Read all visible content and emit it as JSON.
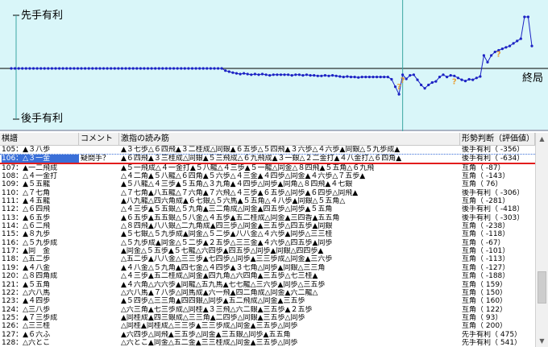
{
  "graph": {
    "label_top": "先手有利",
    "label_bottom": "後手有利",
    "label_end": "終局",
    "colors": {
      "background": "#d9f6f9",
      "line": "#1c22c4",
      "axis": "#000000",
      "grid": "#3aa6a2",
      "marker": "#e8a23a"
    },
    "current_move": 106,
    "evals": [
      0,
      0,
      0,
      0,
      0,
      0,
      0,
      0,
      0,
      0,
      0,
      0,
      0,
      0,
      0,
      0,
      0,
      0,
      0,
      0,
      0,
      0,
      0,
      0,
      0,
      0,
      0,
      0,
      0,
      0,
      0,
      0,
      0,
      0,
      0,
      0,
      0,
      0,
      0,
      0,
      0,
      0,
      0,
      0,
      0,
      0,
      0,
      0,
      0,
      0,
      0,
      0,
      0,
      0,
      0,
      0,
      0,
      0,
      -10,
      -20,
      -30,
      -40,
      -50,
      -40,
      -50,
      -60,
      -50,
      -60,
      -50,
      -60,
      -70,
      -60,
      -60,
      -60,
      -60,
      -60,
      -70,
      -60,
      -60,
      -70,
      -60,
      -70,
      -70,
      -80,
      -80,
      -70,
      -80,
      -70,
      -80,
      -90,
      -100,
      -90,
      -100,
      -100,
      -110,
      -100,
      -100,
      -100,
      -100,
      -100,
      -100,
      -100,
      -100,
      -150,
      -356,
      -634,
      -60,
      -140,
      -70,
      -60,
      -160,
      -300,
      -410,
      -300,
      -230,
      -200,
      -100,
      -60,
      -100,
      -70,
      -80,
      -120,
      -160,
      -190,
      -150,
      -160,
      -120,
      -90,
      200,
      60,
      200,
      300,
      350,
      400,
      450,
      500,
      600,
      700,
      800,
      3500,
      3200,
      500
    ]
  },
  "table": {
    "headers": {
      "move": "棋譜",
      "comment": "コメント",
      "reading": "激指の読み筋",
      "eval": "形勢判断（評価値）"
    },
    "rows": [
      {
        "move": "105：▲３八歩",
        "comment": "",
        "reading": "▲３七歩△６四飛▲３二桂成△同銀▲６五歩△５四飛▲３六歩△４六歩▲同銀△５九歩成▲",
        "eval": "後手有利（ -356）"
      },
      {
        "move": "106：△３一金",
        "comment": "疑問手？",
        "reading": "▲６四飛▲３三桂成△同銀▲５三飛成△６九飛成▲３一銀△２二金打▲４八金打△６四角▲",
        "eval": "後手有利（ -634）"
      },
      {
        "move": "107：▲一二飛成",
        "comment": "",
        "reading": "▲５一飛成△４一金打▲５八龍△４三歩▲５一龍△同金△８四飛▲５五角△６九飛",
        "eval": "互角（ -87）"
      },
      {
        "move": "108：△４一金打",
        "comment": "",
        "reading": "△４二角▲５八龍△６四角▲５六歩△４三金▲４四歩△同金▲４六歩△７五歩▲",
        "eval": "互角（ -143）"
      },
      {
        "move": "109：▲５五龍",
        "comment": "",
        "reading": "▲５八龍△４三歩▲５五角△３九角▲４四歩△同歩▲同角△８四飛▲４七銀",
        "eval": "互角（ 76）"
      },
      {
        "move": "110：△７七角",
        "comment": "",
        "reading": "△７七角▲八五龍△７六角▲７六飛△４三歩▲６五歩△同歩▲６四歩△同飛▲",
        "eval": "後手有利（ -306）"
      },
      {
        "move": "111：▲４五龍",
        "comment": "",
        "reading": "▲八九龍△四六角成▲６七銀△５六馬▲５五角△４八歩▲同銀△５五角△",
        "eval": "互角（ -281）"
      },
      {
        "move": "112：△６四飛",
        "comment": "",
        "reading": "△４三歩▲５五銀△５九角▲三二角成△同金▲四五歩△同歩▲５五角",
        "eval": "後手有利（ -418）"
      },
      {
        "move": "113：▲６五歩",
        "comment": "",
        "reading": "▲６五歩▲五五銀△５八金△４五歩▲五二桂成△同金▲三四香▲五五角",
        "eval": "後手有利（ -303）"
      },
      {
        "move": "114：△６二飛",
        "comment": "",
        "reading": "△８四飛▲八八銀△二九角成▲四三歩△同金▲三五歩△四五歩▲同銀",
        "eval": "互角（ -238）"
      },
      {
        "move": "115：▲８九歩",
        "comment": "",
        "reading": "▲５七銀△５九歩成▲同金△５二歩▲八八金△４六歩▲同歩△三三桂",
        "eval": "互角（ -118）"
      },
      {
        "move": "116：△５九歩成",
        "comment": "",
        "reading": "△５九歩成▲同金△５二歩▲２五歩△三三金▲４六歩△四五歩▲同歩",
        "eval": "互角（ -67）"
      },
      {
        "move": "117：▲同　金",
        "comment": "",
        "reading": "▲同金△５五歩▲５七龍△六四歩▲四五歩△同歩▲同銀△四四歩▲",
        "eval": "互角（ -101）"
      },
      {
        "move": "118：△五二歩",
        "comment": "",
        "reading": "△五二歩▲八八金△三三歩▲七四歩△同歩▲三三歩成△同金▲三六歩",
        "eval": "互角（ -113）"
      },
      {
        "move": "119：▲４八金",
        "comment": "",
        "reading": "▲４八金△５九角▲四七金△４四歩▲３七角△同歩▲同銀△三三角",
        "eval": "互角（ -127）"
      },
      {
        "move": "120：△８四角成",
        "comment": "",
        "reading": "△４三歩▲五二桂成△同金▲四九角△六四角▲三五歩△七三桂▲",
        "eval": "互角（ -188）"
      },
      {
        "move": "121：▲５五角",
        "comment": "",
        "reading": "▲４六角△六六歩▲同龍△五九馬▲七七龍△三六歩▲同歩△三五歩",
        "eval": "互角（ 159）"
      },
      {
        "move": "122：△六八馬",
        "comment": "",
        "reading": "△六八馬▲７八歩△同馬成▲六一飛▲四二角成△同金▲六二龍△",
        "eval": "互角（ 150）"
      },
      {
        "move": "123：▲４四歩",
        "comment": "",
        "reading": "▲５四歩△三三角▲四四銀△同歩▲五二飛成△同金▲三五歩",
        "eval": "互角（ 160）"
      },
      {
        "move": "124：△三八歩",
        "comment": "",
        "reading": "△六三角▲七三歩成△同桂▲３三飛△六二銀▲三五歩▲２五歩",
        "eval": "互角（ 122）"
      },
      {
        "move": "125：▲７三歩成",
        "comment": "",
        "reading": "▲同桂成▲四三銀成△三三角▲二四歩△同銀▲三五歩△同歩",
        "eval": "互角（ 93）"
      },
      {
        "move": "126：△三三桂",
        "comment": "",
        "reading": "△同桂▲同桂成△三三歩▲三三歩成△同金▲三五歩△同歩",
        "eval": "互角（ 200）"
      },
      {
        "move": "127：▲６六ふ",
        "comment": "",
        "reading": "▲六四歩△同飛▲三五歩△同金▲三五銀△同歩▲五五角",
        "eval": "先手有利（ 475）"
      },
      {
        "move": "128：△六とこ",
        "comment": "",
        "reading": "△六とこ▲同金△五二金▲三三桂成△同金▲三五歩△同歩",
        "eval": "先手有利（ 541）"
      }
    ]
  }
}
